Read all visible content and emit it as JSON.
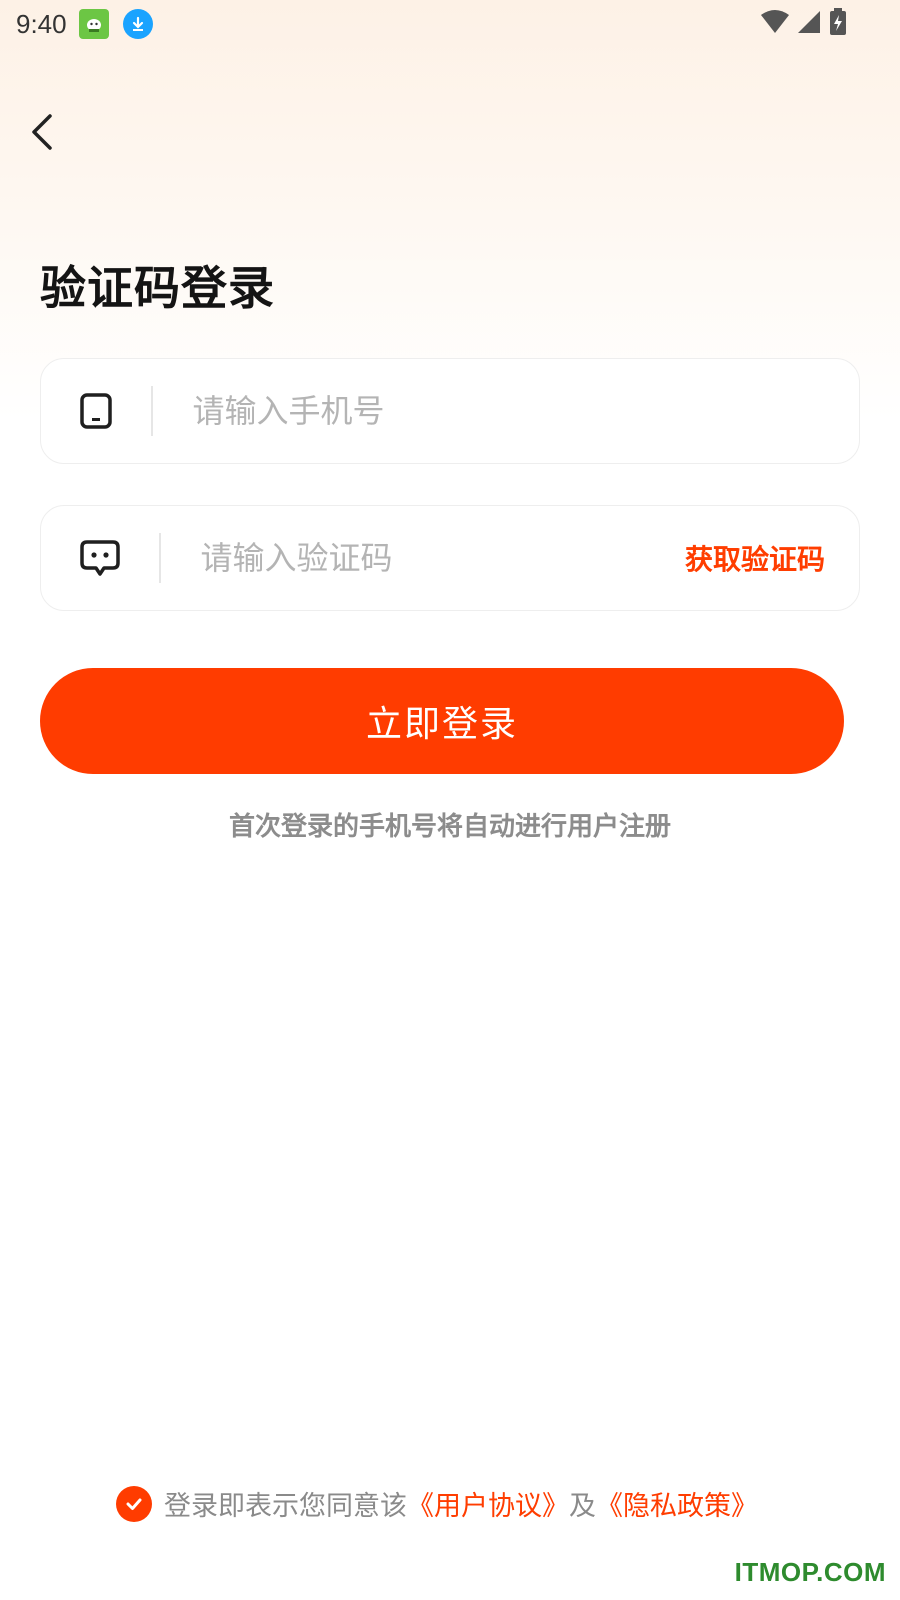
{
  "status_bar": {
    "time": "9:40"
  },
  "header": {
    "title": "验证码登录"
  },
  "phone_field": {
    "placeholder": "请输入手机号"
  },
  "code_field": {
    "placeholder": "请输入验证码",
    "get_code_label": "获取验证码"
  },
  "login_button": {
    "label": "立即登录"
  },
  "register_note": "首次登录的手机号将自动进行用户注册",
  "agreement": {
    "prefix": "登录即表示您同意该",
    "user_agreement": "《用户协议》",
    "and": "及",
    "privacy_policy": "《隐私政策》"
  },
  "watermark": "ITMOP.COM",
  "colors": {
    "accent": "#ff3c00",
    "placeholder": "#b4b4b4",
    "note": "#8c8c8c"
  }
}
